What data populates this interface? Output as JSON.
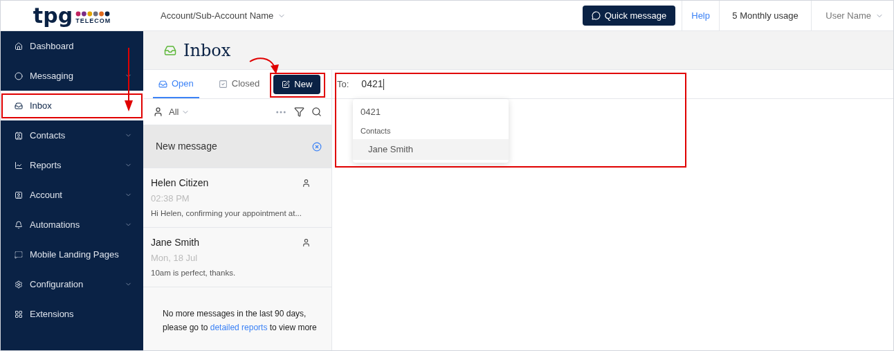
{
  "logo": {
    "wordmark": "tpg",
    "subtitle": "TELECOM"
  },
  "header": {
    "account": "Account/Sub-Account Name",
    "quick_message": "Quick message",
    "help": "Help",
    "usage": "5 Monthly usage",
    "user": "User Name"
  },
  "sidebar": {
    "items": [
      {
        "label": "Dashboard",
        "selected": false,
        "expandable": false
      },
      {
        "label": "Messaging",
        "selected": false,
        "expandable": true
      },
      {
        "label": "Inbox",
        "selected": true,
        "expandable": false
      },
      {
        "label": "Contacts",
        "selected": false,
        "expandable": true
      },
      {
        "label": "Reports",
        "selected": false,
        "expandable": true
      },
      {
        "label": "Account",
        "selected": false,
        "expandable": true
      },
      {
        "label": "Automations",
        "selected": false,
        "expandable": true
      },
      {
        "label": "Mobile Landing Pages",
        "selected": false,
        "expandable": false
      },
      {
        "label": "Configuration",
        "selected": false,
        "expandable": true
      },
      {
        "label": "Extensions",
        "selected": false,
        "expandable": false
      }
    ]
  },
  "page_title": "Inbox",
  "tabs": [
    {
      "label": "Open",
      "selected": true
    },
    {
      "label": "Closed",
      "selected": false
    }
  ],
  "new_button": "New",
  "filter": {
    "assignee": "All"
  },
  "conversations": [
    {
      "kind": "draft",
      "title": "New message",
      "selected": true
    },
    {
      "kind": "message",
      "name": "Helen Citizen",
      "time": "02:38 PM",
      "preview": "Hi Helen, confirming your appointment at...",
      "selected": false
    },
    {
      "kind": "message",
      "name": "Jane Smith",
      "time": "Mon, 18 Jul",
      "preview": "10am is perfect, thanks.",
      "selected": false
    }
  ],
  "list_footer": {
    "before": "No more messages in the last 90 days, please go to ",
    "link": "detailed reports",
    "after": " to view more"
  },
  "compose": {
    "to_label": "To:",
    "to_value": "0421",
    "suggestions": [
      {
        "kind": "option",
        "label": "0421",
        "selected": false
      },
      {
        "kind": "group",
        "label": "Contacts"
      },
      {
        "kind": "option",
        "label": "Jane Smith",
        "selected": true
      }
    ]
  }
}
